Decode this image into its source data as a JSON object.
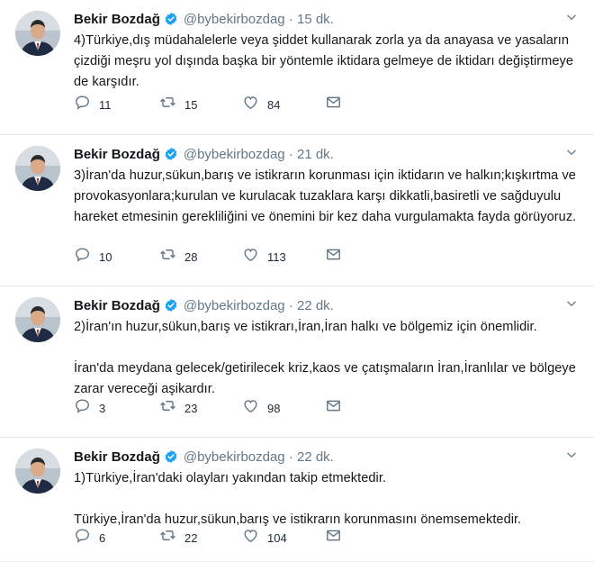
{
  "colors": {
    "icon": "#657786",
    "verified": "#1da1f2",
    "divider": "#e6ecf0"
  },
  "tweets": [
    {
      "name": "Bekir Bozdağ",
      "handle_time": "@bybekirbozdag · 15 dk.",
      "paragraphs": [
        "4)Türkiye,dış müdahalelerle veya  şiddet kullanarak zorla ya da anayasa ve yasaların çizdiği meşru yol dışında başka bir yöntemle iktidara gelmeye de iktidarı değiştirmeye de karşıdır."
      ],
      "replies": "11",
      "retweets": "15",
      "likes": "84"
    },
    {
      "name": "Bekir Bozdağ",
      "handle_time": "@bybekirbozdag · 21 dk.",
      "paragraphs": [
        "3)İran'da huzur,sükun,barış ve istikrarın korunması için iktidarın ve halkın;kışkırtma ve provokasyonlara;kurulan ve kurulacak tuzaklara karşı dikkatli,basiretli ve sağduyulu hareket etmesinin gerekliliğini ve önemini bir kez daha vurgulamakta fayda görüyoruz."
      ],
      "replies": "10",
      "retweets": "28",
      "likes": "113"
    },
    {
      "name": "Bekir Bozdağ",
      "handle_time": "@bybekirbozdag · 22 dk.",
      "paragraphs": [
        "2)İran'ın huzur,sükun,barış ve istikrarı,İran,İran halkı ve bölgemiz için önemlidir.",
        "İran'da meydana gelecek/getirilecek kriz,kaos ve çatışmaların İran,İranlılar ve bölgeye zarar vereceği aşikardır."
      ],
      "replies": "3",
      "retweets": "23",
      "likes": "98"
    },
    {
      "name": "Bekir Bozdağ",
      "handle_time": "@bybekirbozdag · 22 dk.",
      "paragraphs": [
        "1)Türkiye,İran'daki olayları yakından takip etmektedir.",
        "Türkiye,İran'da huzur,sükun,barış ve istikrarın korunmasını önemsemektedir."
      ],
      "replies": "6",
      "retweets": "22",
      "likes": "104"
    }
  ]
}
